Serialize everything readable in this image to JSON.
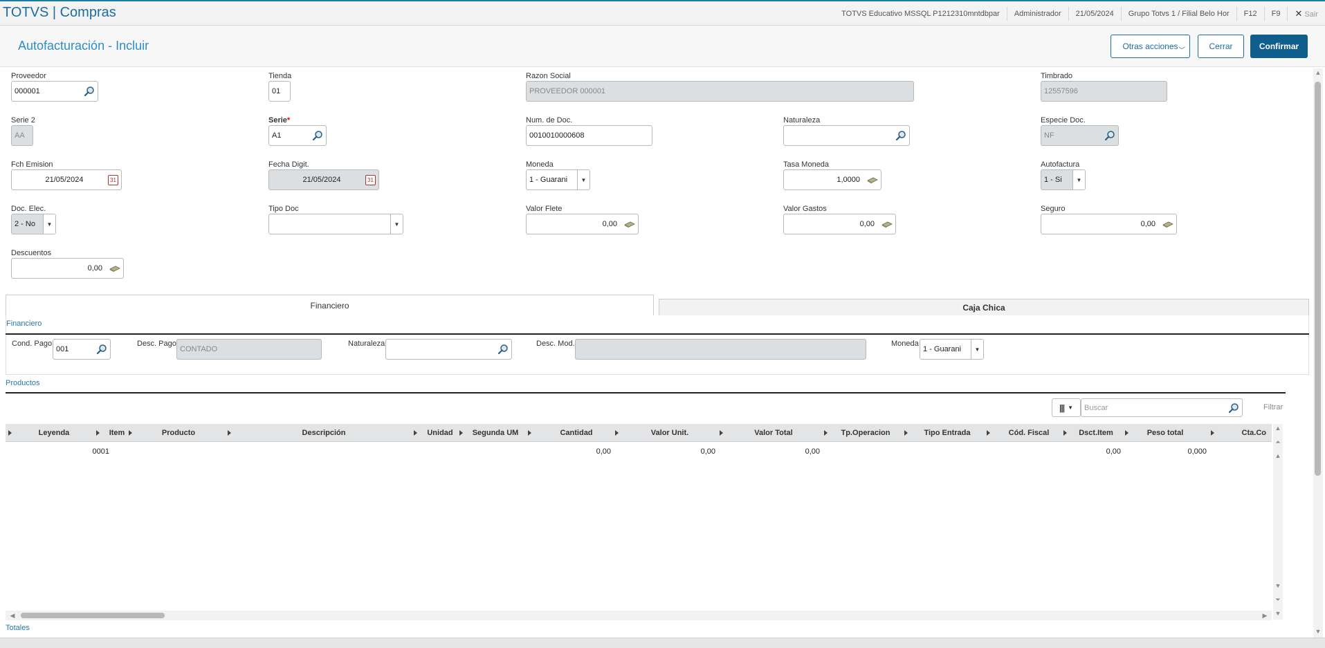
{
  "app": {
    "title": "TOTVS | Compras"
  },
  "topbar": {
    "environment": "TOTVS Educativo MSSQL P1212310mntdbpar",
    "user": "Administrador",
    "date": "21/05/2024",
    "branch": "Grupo Totvs 1 / Filial Belo Hor",
    "f12": "F12",
    "f9": "F9",
    "exit": "Sair"
  },
  "header": {
    "title": "Autofacturación - Incluir",
    "otras": "Otras acciones",
    "cerrar": "Cerrar",
    "confirmar": "Confirmar"
  },
  "form": {
    "proveedor": {
      "label": "Proveedor",
      "value": "000001"
    },
    "tienda": {
      "label": "Tienda",
      "value": "01"
    },
    "razon": {
      "label": "Razon Social",
      "value": "PROVEEDOR 000001"
    },
    "timbrado": {
      "label": "Timbrado",
      "value": "12557596"
    },
    "serie2": {
      "label": "Serie 2",
      "value": "AA"
    },
    "serie": {
      "label": "Serie",
      "required": "*",
      "value": "A1"
    },
    "numdoc": {
      "label": "Num. de Doc.",
      "value": "0010010000608"
    },
    "naturaleza": {
      "label": "Naturaleza",
      "value": ""
    },
    "especie": {
      "label": "Especie Doc.",
      "value": "NF"
    },
    "fchemision": {
      "label": "Fch Emision",
      "value": "21/05/2024"
    },
    "fechadigit": {
      "label": "Fecha Digit.",
      "value": "21/05/2024"
    },
    "moneda": {
      "label": "Moneda",
      "value": "1 - Guarani"
    },
    "tasa": {
      "label": "Tasa Moneda",
      "value": "1,0000"
    },
    "autofactura": {
      "label": "Autofactura",
      "value": "1 - Si"
    },
    "docelec": {
      "label": "Doc. Elec.",
      "value": "2 - No"
    },
    "tipodoc": {
      "label": "Tipo Doc",
      "value": ""
    },
    "flete": {
      "label": "Valor Flete",
      "value": "0,00"
    },
    "gastos": {
      "label": "Valor Gastos",
      "value": "0,00"
    },
    "seguro": {
      "label": "Seguro",
      "value": "0,00"
    },
    "descuentos": {
      "label": "Descuentos",
      "value": "0,00"
    }
  },
  "tabs": {
    "financiero": "Financiero",
    "caja": "Caja Chica"
  },
  "financiero": {
    "section": "Financiero",
    "condpago": {
      "label": "Cond. Pago",
      "value": "001"
    },
    "descpago": {
      "label": "Desc. Pago",
      "value": "CONTADO"
    },
    "naturaleza": {
      "label": "Naturaleza",
      "value": ""
    },
    "descmod": {
      "label": "Desc. Mod.",
      "value": ""
    },
    "moneda": {
      "label": "Moneda",
      "value": "1 - Guarani"
    }
  },
  "productos": {
    "section": "Productos",
    "search_placeholder": "Buscar",
    "filter": "Filtrar",
    "columns": [
      "Leyenda",
      "Item",
      "Producto",
      "Descripción",
      "Unidad",
      "Segunda UM",
      "Cantidad",
      "Valor Unit.",
      "Valor Total",
      "Tp.Operacion",
      "Tipo Entrada",
      "Cód. Fiscal",
      "Dsct.Item",
      "Peso total",
      "Cta.Co"
    ],
    "row": {
      "item": "0001",
      "cantidad": "0,00",
      "valorunit": "0,00",
      "valortotal": "0,00",
      "dsct": "0,00",
      "peso": "0,000"
    }
  },
  "totales": "Totales"
}
